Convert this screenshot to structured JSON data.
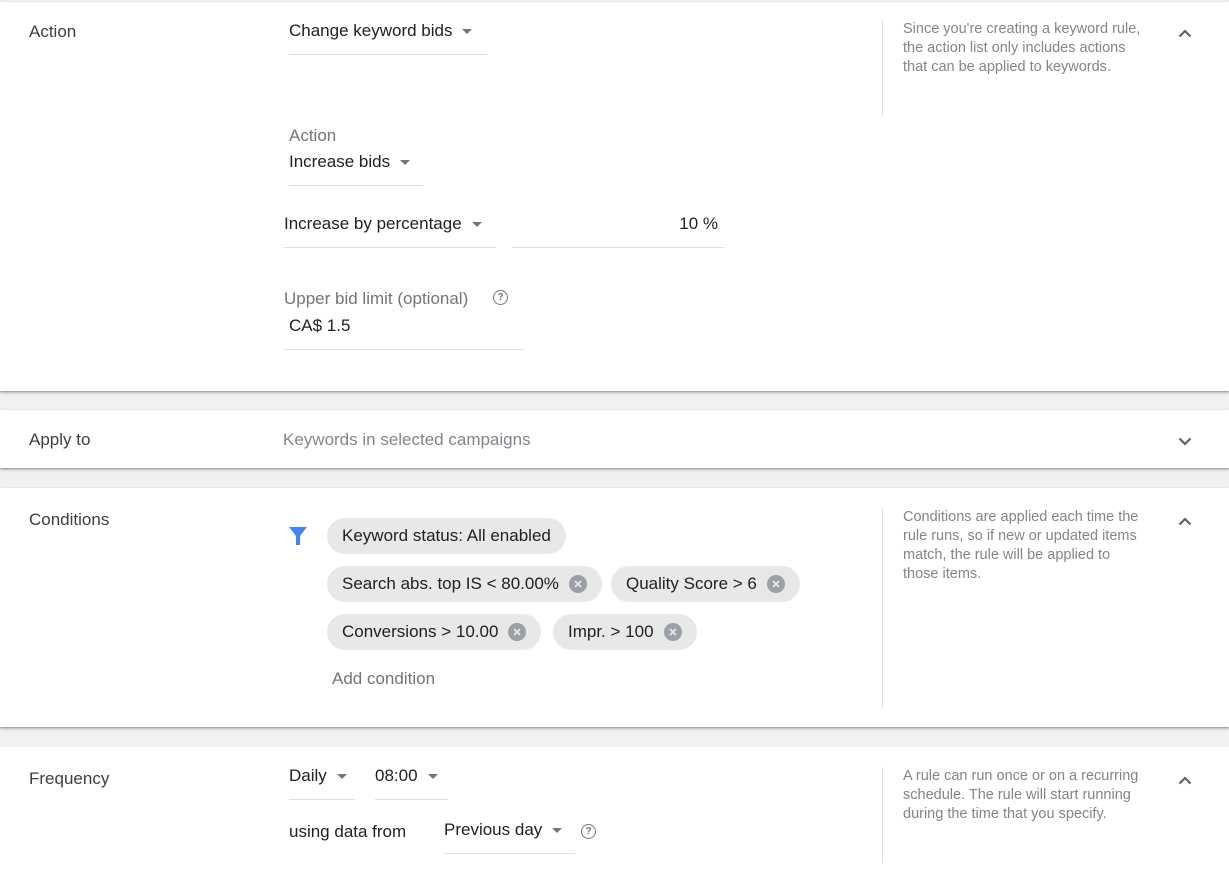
{
  "action_section": {
    "label": "Action",
    "rule_action_dropdown": "Change keyword bids",
    "sub_action_label": "Action",
    "sub_action_dropdown": "Increase bids",
    "increase_method_dropdown": "Increase by percentage",
    "percentage_value": "10 %",
    "upper_bid_label": "Upper bid limit (optional)",
    "upper_bid_value": "CA$ 1.5",
    "help_text": "Since you're creating a keyword rule, the action list only includes actions that can be applied to keywords.",
    "expanded": true
  },
  "apply_to_section": {
    "label": "Apply to",
    "summary": "Keywords in selected campaigns",
    "expanded": false
  },
  "conditions_section": {
    "label": "Conditions",
    "filter_icon_color": "#4285f4",
    "chips": [
      {
        "text": "Keyword status: All enabled",
        "removable": false
      },
      {
        "text": "Search abs. top IS < 80.00%",
        "removable": true
      },
      {
        "text": "Quality Score > 6",
        "removable": true
      },
      {
        "text": "Conversions > 10.00",
        "removable": true
      },
      {
        "text": "Impr. > 100",
        "removable": true
      }
    ],
    "add_condition_label": "Add condition",
    "help_text": "Conditions are applied each time the rule runs, so if new or updated items match, the rule will be applied to those items.",
    "expanded": true
  },
  "frequency_section": {
    "label": "Frequency",
    "frequency_dropdown": "Daily",
    "time_dropdown": "08:00",
    "using_data_label": "using data from",
    "data_range_dropdown": "Previous day",
    "help_text": "A rule can run once or on a recurring schedule. The rule will start running during the time that you specify.",
    "expanded": true
  }
}
